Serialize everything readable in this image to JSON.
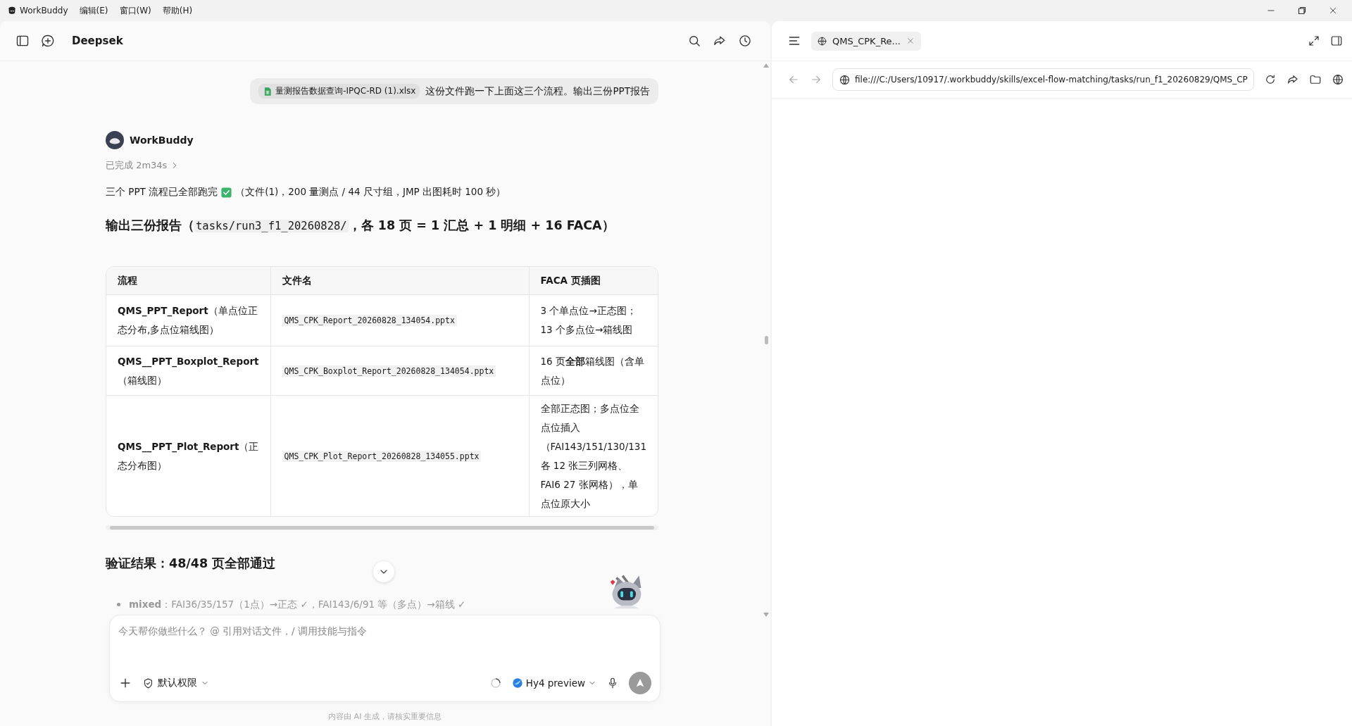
{
  "menu_bar": {
    "app_name": "WorkBuddy",
    "items": [
      "编辑(E)",
      "窗口(W)",
      "帮助(H)"
    ]
  },
  "chat": {
    "title": "Deepsek",
    "user_message": {
      "attachment": "量测报告数据查询-IPQC-RD (1).xlsx",
      "text": "这份文件跑一下上面这三个流程。输出三份PPT报告"
    },
    "assistant": {
      "name": "WorkBuddy",
      "status": "已完成 2m34s",
      "expanded": false,
      "summary": [
        {
          "kind": "text",
          "text": "三个 PPT 流程已全部跑完"
        },
        {
          "kind": "check"
        },
        {
          "kind": "text",
          "text": "（文件(1)，200 量测点 / 44 尺寸组，JMP 出图耗时 100 秒）"
        }
      ],
      "heading": [
        {
          "kind": "text",
          "text": "输出三份报告（"
        },
        {
          "kind": "code",
          "text": "tasks/run3_f1_20260828/"
        },
        {
          "kind": "text",
          "text": "，各 18 页 = 1 汇总 + 1 明细 + 16 FACA）"
        }
      ],
      "table": {
        "columns": [
          "流程",
          "文件名",
          "FACA 页插图"
        ],
        "rows": [
          [
            "**QMS_PPT_Report**（单点位正态分布,多点位箱线图）",
            "QMS_CPK_Report_20260828_134054.pptx",
            "3 个单点位→正态图；13 个多点位→箱线图"
          ],
          [
            "**QMS__PPT_Boxplot_Report**（箱线图）",
            "QMS_CPK_Boxplot_Report_20260828_134054.pptx",
            "16 页**全部**箱线图（含单点位）"
          ],
          [
            "**QMS__PPT_Plot_Report**（正态分布图）",
            "QMS_CPK_Plot_Report_20260828_134055.pptx",
            "全部正态图；多点位全点位插入（FAI143/151/130/131 各 12 张三列网格、FAI6 27 张网格），单点位原大小"
          ]
        ]
      },
      "verify_heading": "验证结果：48/48 页全部通过",
      "bullets": [
        "**mixed**：FAI36/35/157（1点）→正态 ✓，FAI143/6/91 等（多点）→箱线 ✓"
      ]
    },
    "input": {
      "placeholder": "今天帮你做些什么？ @ 引用对话文件，/ 调用技能与指令",
      "permission": "默认权限",
      "model": "Hy4 preview"
    },
    "footer": "内容由 AI 生成，请核实重要信息"
  },
  "browser": {
    "tabs": [
      {
        "label": "QMS_CPK_Re...",
        "selected": true
      }
    ],
    "address": "file:///C:/Users/10917/.workbuddy/skills/excel-flow-matching/tasks/run_f1_20260829/QMS_CP"
  }
}
